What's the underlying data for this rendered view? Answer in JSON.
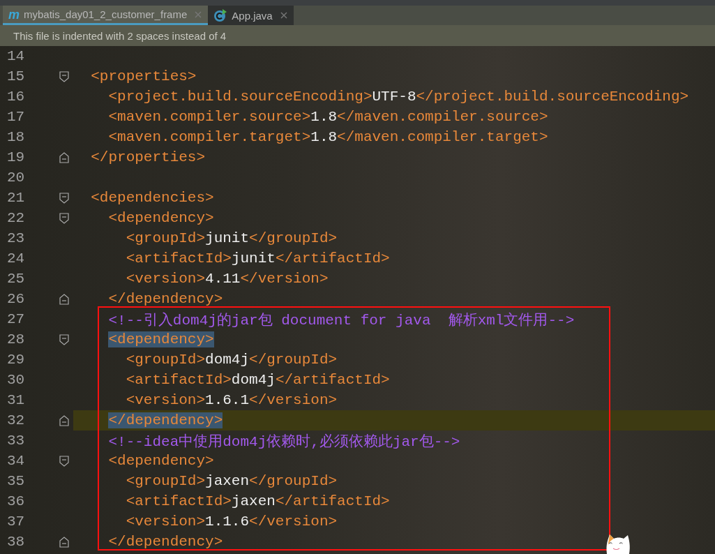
{
  "tabs": [
    {
      "label": "mybatis_day01_2_customer_frame",
      "glyph": "m",
      "selected": true
    },
    {
      "label": "App.java",
      "selected": false
    }
  ],
  "notice": "This file is indented with 2 spaces instead of 4",
  "code_blocks": [
    {
      "kind": "plain",
      "lines": [
        {
          "number": "14",
          "kind": "plain",
          "current": false
        },
        {
          "number": "15",
          "kind": "fold-start",
          "current": false,
          "tokens": [
            {
              "kind": "tag",
              "text": "  <properties>",
              "matched": false
            }
          ]
        },
        {
          "number": "16",
          "kind": "plain",
          "current": false,
          "tokens": [
            {
              "kind": "tag",
              "text": "    <project.build.sourceEncoding>",
              "matched": false
            },
            {
              "kind": "text",
              "text": "UTF-8"
            },
            {
              "kind": "tag",
              "text": "</project.build.sourceEncoding>",
              "matched": false
            }
          ]
        },
        {
          "number": "17",
          "kind": "plain",
          "current": false,
          "tokens": [
            {
              "kind": "tag",
              "text": "    <maven.compiler.source>",
              "matched": false
            },
            {
              "kind": "text",
              "text": "1.8"
            },
            {
              "kind": "tag",
              "text": "</maven.compiler.source>",
              "matched": false
            }
          ]
        },
        {
          "number": "18",
          "kind": "plain",
          "current": false,
          "tokens": [
            {
              "kind": "tag",
              "text": "    <maven.compiler.target>",
              "matched": false
            },
            {
              "kind": "text",
              "text": "1.8"
            },
            {
              "kind": "tag",
              "text": "</maven.compiler.target>",
              "matched": false
            }
          ]
        },
        {
          "number": "19",
          "kind": "fold-end",
          "current": false,
          "tokens": [
            {
              "kind": "tag",
              "text": "  </properties>",
              "matched": false
            }
          ]
        },
        {
          "number": "20",
          "kind": "plain",
          "current": false
        },
        {
          "number": "21",
          "kind": "fold-start",
          "current": false,
          "tokens": [
            {
              "kind": "tag",
              "text": "  <dependencies>",
              "matched": false
            }
          ]
        },
        {
          "number": "22",
          "kind": "fold-start",
          "current": false,
          "tokens": [
            {
              "kind": "tag",
              "text": "    <dependency>",
              "matched": false
            }
          ]
        },
        {
          "number": "23",
          "kind": "plain",
          "current": false,
          "tokens": [
            {
              "kind": "tag",
              "text": "      <groupId>",
              "matched": false
            },
            {
              "kind": "text",
              "text": "junit"
            },
            {
              "kind": "tag",
              "text": "</groupId>",
              "matched": false
            }
          ]
        },
        {
          "number": "24",
          "kind": "plain",
          "current": false,
          "tokens": [
            {
              "kind": "tag",
              "text": "      <artifactId>",
              "matched": false
            },
            {
              "kind": "text",
              "text": "junit"
            },
            {
              "kind": "tag",
              "text": "</artifactId>",
              "matched": false
            }
          ]
        },
        {
          "number": "25",
          "kind": "plain",
          "current": false,
          "tokens": [
            {
              "kind": "tag",
              "text": "      <version>",
              "matched": false
            },
            {
              "kind": "text",
              "text": "4.11"
            },
            {
              "kind": "tag",
              "text": "</version>",
              "matched": false
            }
          ]
        },
        {
          "number": "26",
          "kind": "fold-end",
          "current": false,
          "tokens": [
            {
              "kind": "tag",
              "text": "    </dependency>",
              "matched": false
            }
          ]
        }
      ]
    },
    {
      "kind": "red-box",
      "lines": [
        {
          "number": "27",
          "kind": "plain",
          "current": false,
          "tokens": [
            {
              "kind": "comment",
              "text": "    <!--引入dom4j的jar包 document for java  解析xml文件用-->"
            }
          ]
        },
        {
          "number": "28",
          "kind": "fold-start",
          "current": false,
          "tokens": [
            {
              "kind": "tag",
              "text": "    <dependency>",
              "matched": true
            }
          ]
        },
        {
          "number": "29",
          "kind": "plain",
          "current": false,
          "tokens": [
            {
              "kind": "tag",
              "text": "      <groupId>",
              "matched": false
            },
            {
              "kind": "text",
              "text": "dom4j"
            },
            {
              "kind": "tag",
              "text": "</groupId>",
              "matched": false
            }
          ]
        },
        {
          "number": "30",
          "kind": "plain",
          "current": false,
          "tokens": [
            {
              "kind": "tag",
              "text": "      <artifactId>",
              "matched": false
            },
            {
              "kind": "text",
              "text": "dom4j"
            },
            {
              "kind": "tag",
              "text": "</artifactId>",
              "matched": false
            }
          ]
        },
        {
          "number": "31",
          "kind": "plain",
          "current": false,
          "tokens": [
            {
              "kind": "tag",
              "text": "      <version>",
              "matched": false
            },
            {
              "kind": "text",
              "text": "1.6.1"
            },
            {
              "kind": "tag",
              "text": "</version>",
              "matched": false
            }
          ]
        },
        {
          "number": "32",
          "kind": "fold-end",
          "current": true,
          "tokens": [
            {
              "kind": "tag",
              "text": "    </dependency>",
              "matched": true
            }
          ]
        },
        {
          "number": "33",
          "kind": "plain",
          "current": false,
          "tokens": [
            {
              "kind": "comment",
              "text": "    <!--idea中使用dom4j依赖时,必须依赖此jar包-->"
            }
          ]
        },
        {
          "number": "34",
          "kind": "fold-start",
          "current": false,
          "tokens": [
            {
              "kind": "tag",
              "text": "    <dependency>",
              "matched": false
            }
          ]
        },
        {
          "number": "35",
          "kind": "plain",
          "current": false,
          "tokens": [
            {
              "kind": "tag",
              "text": "      <groupId>",
              "matched": false
            },
            {
              "kind": "text",
              "text": "jaxen"
            },
            {
              "kind": "tag",
              "text": "</groupId>",
              "matched": false
            }
          ]
        },
        {
          "number": "36",
          "kind": "plain",
          "current": false,
          "tokens": [
            {
              "kind": "tag",
              "text": "      <artifactId>",
              "matched": false
            },
            {
              "kind": "text",
              "text": "jaxen"
            },
            {
              "kind": "tag",
              "text": "</artifactId>",
              "matched": false
            }
          ]
        },
        {
          "number": "37",
          "kind": "plain",
          "current": false,
          "tokens": [
            {
              "kind": "tag",
              "text": "      <version>",
              "matched": false
            },
            {
              "kind": "text",
              "text": "1.1.6"
            },
            {
              "kind": "tag",
              "text": "</version>",
              "matched": false
            }
          ]
        },
        {
          "number": "38",
          "kind": "fold-end",
          "current": false,
          "tokens": [
            {
              "kind": "tag",
              "text": "    </dependency>",
              "matched": false
            }
          ]
        }
      ]
    }
  ]
}
